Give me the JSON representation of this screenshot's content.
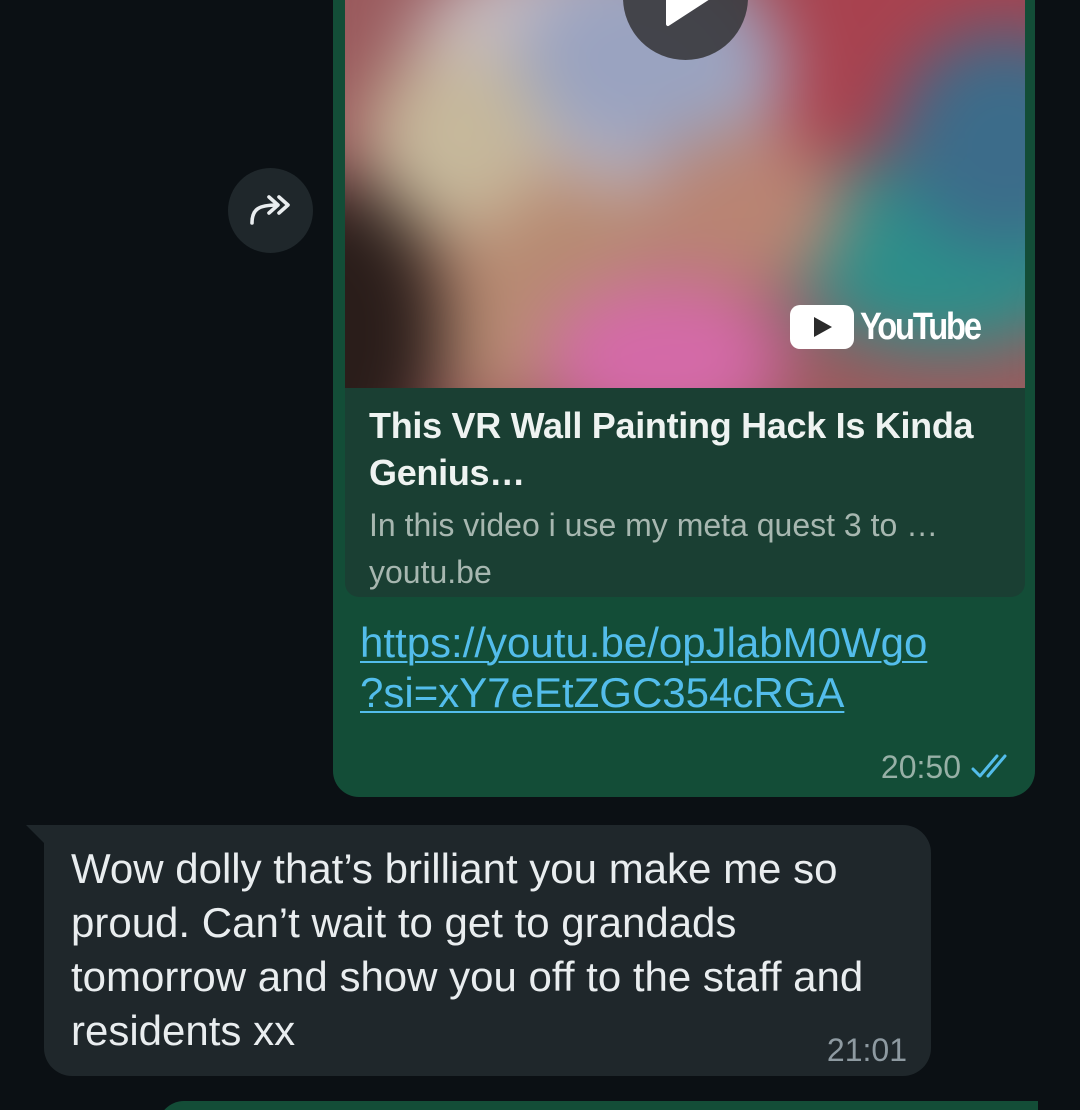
{
  "colors": {
    "background": "#0b1014",
    "outgoing_bubble": "#134d37",
    "incoming_bubble": "#1f272b",
    "link": "#53bdeb",
    "read_ticks": "#53bdeb"
  },
  "forward": {
    "icon": "forward-icon"
  },
  "outgoing_message": {
    "preview": {
      "play_icon": "play-icon",
      "badge_text": "YouTube",
      "title": "This VR Wall Painting Hack Is Kinda Genius…",
      "description": "In this video i use my meta quest 3 to …",
      "domain": "youtu.be"
    },
    "link_line1": "https://youtu.be/opJlabM0Wgo",
    "link_line2": "?si=xY7eEtZGC354cRGA",
    "time": "20:50",
    "status_icon": "double-check-icon",
    "status": "read"
  },
  "incoming_message": {
    "text": "Wow dolly that’s brilliant you make me so proud. Can’t wait to get to grandads tomorrow and show you off to the staff and residents xx",
    "time": "21:01"
  }
}
